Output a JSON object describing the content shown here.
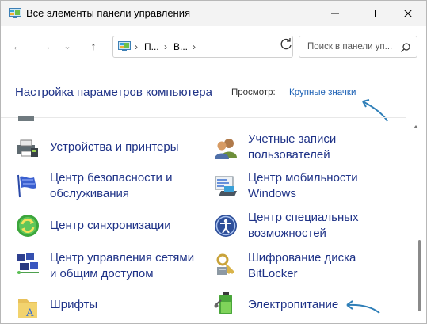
{
  "window": {
    "title": "Все элементы панели управления",
    "controls": {
      "minimize": "minimize",
      "maximize": "maximize",
      "close": "close"
    }
  },
  "nav": {
    "back": "←",
    "forward": "→",
    "recent": "⌄",
    "up": "↑",
    "breadcrumbs": [
      "П...",
      "В..."
    ],
    "search_placeholder": "Поиск в панели уп..."
  },
  "header": {
    "title": "Настройка параметров компьютера",
    "view_label": "Просмотр:",
    "view_value": "Крупные значки"
  },
  "items": [
    {
      "id": "devices",
      "label": "Устройства и принтеры",
      "icon": "printer-icon"
    },
    {
      "id": "accounts",
      "label": "Учетные записи пользователей",
      "icon": "users-icon"
    },
    {
      "id": "security",
      "label": "Центр безопасности и обслуживания",
      "icon": "flag-icon"
    },
    {
      "id": "mobility",
      "label": "Центр мобильности Windows",
      "icon": "mobility-icon"
    },
    {
      "id": "sync",
      "label": "Центр синхронизации",
      "icon": "sync-icon"
    },
    {
      "id": "access",
      "label": "Центр специальных возможностей",
      "icon": "accessibility-icon"
    },
    {
      "id": "network",
      "label": "Центр управления сетями и общим доступом",
      "icon": "network-icon"
    },
    {
      "id": "bitlocker",
      "label": "Шифрование диска BitLocker",
      "icon": "bitlocker-icon"
    },
    {
      "id": "fonts",
      "label": "Шрифты",
      "icon": "fonts-icon"
    },
    {
      "id": "power",
      "label": "Электропитание",
      "icon": "power-icon"
    }
  ],
  "colors": {
    "link": "#1e3287",
    "accent": "#1a5fb4",
    "annotation": "#2f7fb8"
  }
}
